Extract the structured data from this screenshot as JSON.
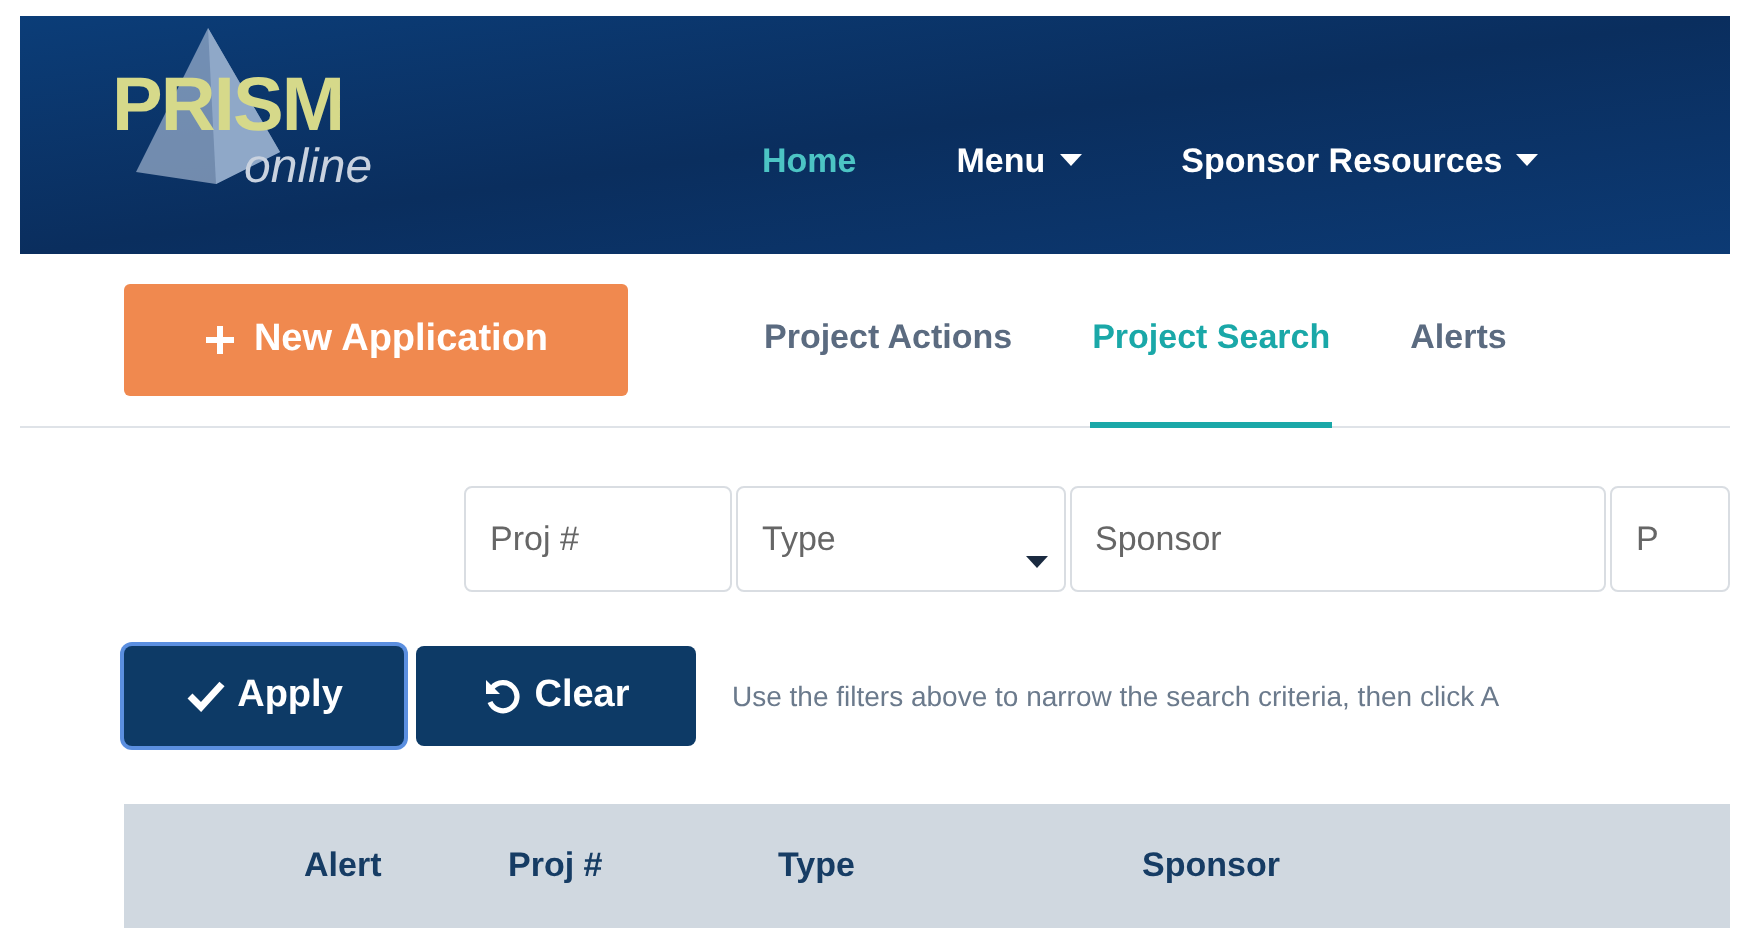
{
  "header": {
    "logo": {
      "title": "PRISM",
      "subtitle": "online"
    },
    "nav": [
      {
        "label": "Home",
        "selected": true,
        "dropdown": false
      },
      {
        "label": "Menu",
        "selected": false,
        "dropdown": true
      },
      {
        "label": "Sponsor Resources",
        "selected": false,
        "dropdown": true
      }
    ]
  },
  "new_application_button": {
    "label": "New Application"
  },
  "tabs": [
    {
      "label": "Project Actions",
      "selected": false
    },
    {
      "label": "Project Search",
      "selected": true
    },
    {
      "label": "Alerts",
      "selected": false
    }
  ],
  "filters": [
    {
      "kind": "text",
      "placeholder": "Proj #"
    },
    {
      "kind": "select",
      "placeholder": "Type"
    },
    {
      "kind": "text",
      "placeholder": "Sponsor"
    },
    {
      "kind": "text",
      "placeholder": "P"
    }
  ],
  "buttons": [
    {
      "kind": "apply",
      "label": "Apply",
      "focused": true
    },
    {
      "kind": "clear",
      "label": "Clear",
      "focused": false
    }
  ],
  "hint": "Use the filters above to narrow the search criteria, then click A",
  "table": {
    "columns": [
      "Alert",
      "Proj #",
      "Type",
      "Sponsor"
    ]
  }
}
